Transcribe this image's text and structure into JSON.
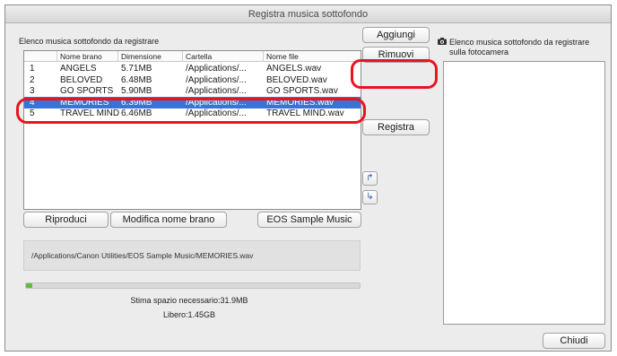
{
  "window": {
    "title": "Registra musica sottofondo"
  },
  "list_section": {
    "label": "Elenco musica sottofondo da registrare",
    "columns": [
      "",
      "Nome brano",
      "Dimensione",
      "Cartella",
      "Nome file"
    ],
    "rows": [
      {
        "num": "1",
        "title": "ANGELS",
        "size": "5.71MB",
        "folder": "/Applications/...",
        "file": "ANGELS.wav"
      },
      {
        "num": "2",
        "title": "BELOVED",
        "size": "6.48MB",
        "folder": "/Applications/...",
        "file": "BELOVED.wav"
      },
      {
        "num": "3",
        "title": "GO SPORTS",
        "size": "5.90MB",
        "folder": "/Applications/...",
        "file": "GO SPORTS.wav"
      },
      {
        "num": "4",
        "title": "MEMORIES",
        "size": "6.39MB",
        "folder": "/Applications/...",
        "file": "MEMORIES.wav"
      },
      {
        "num": "5",
        "title": "TRAVEL MIND",
        "size": "6.46MB",
        "folder": "/Applications/...",
        "file": "TRAVEL MIND.wav"
      }
    ],
    "selected_index": 3
  },
  "buttons": {
    "add": "Aggiungi",
    "remove": "Rimuovi",
    "register": "Registra",
    "play": "Riproduci",
    "edit_title": "Modifica nome brano",
    "eos_sample": "EOS Sample Music",
    "close": "Chiudi"
  },
  "icons": {
    "move_up": "move-up-icon",
    "move_down": "move-down-icon",
    "camera": "camera-icon"
  },
  "path_display": "/Applications/Canon Utilities/EOS Sample Music/MEMORIES.wav",
  "progress": {
    "fraction": 0.02,
    "color": "#5fbf3d"
  },
  "space": {
    "needed": "Stima spazio necessario:31.9MB",
    "free": "Libero:1.45GB"
  },
  "camera_section": {
    "label_line1": "Elenco musica sottofondo da registrare",
    "label_line2": "sulla fotocamera"
  },
  "colors": {
    "selection": "#3874d8",
    "highlight": "#e8141e"
  }
}
